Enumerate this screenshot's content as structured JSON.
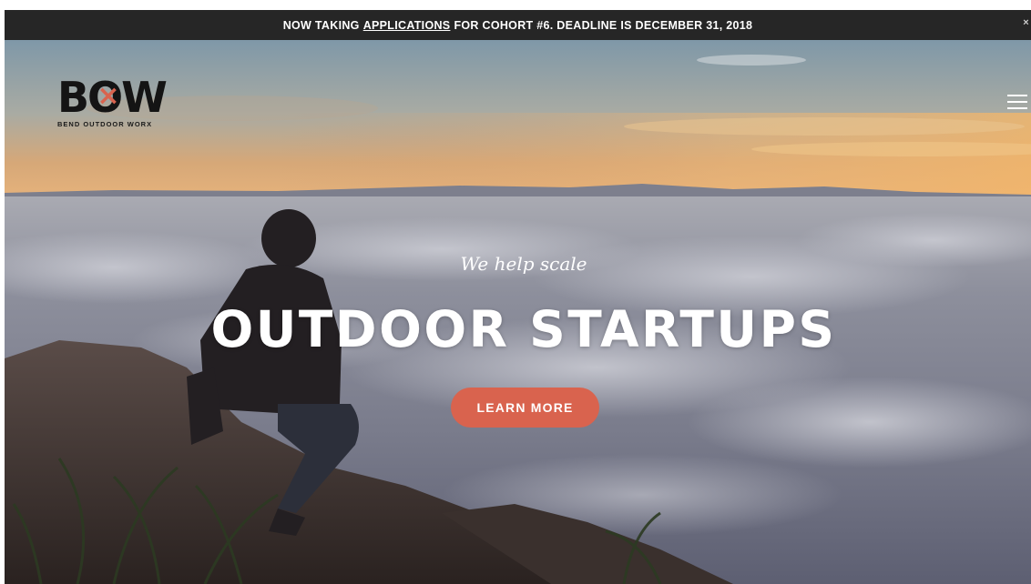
{
  "announcement": {
    "prefix": "NOW TAKING",
    "link": "APPLICATIONS",
    "suffix": "FOR COHORT #6. DEADLINE IS DECEMBER 31, 2018",
    "close": "×"
  },
  "logo": {
    "mark": "BOW",
    "x_glyph": "×",
    "subtitle": "BEND OUTDOOR WORX"
  },
  "hero": {
    "tagline": "We help scale",
    "headline": "OUTDOOR STARTUPS",
    "cta_label": "LEARN MORE"
  },
  "colors": {
    "accent": "#d9634e",
    "bar": "#262626",
    "text": "#ffffff"
  },
  "icons": {
    "menu": "hamburger-icon",
    "close": "close-icon"
  }
}
